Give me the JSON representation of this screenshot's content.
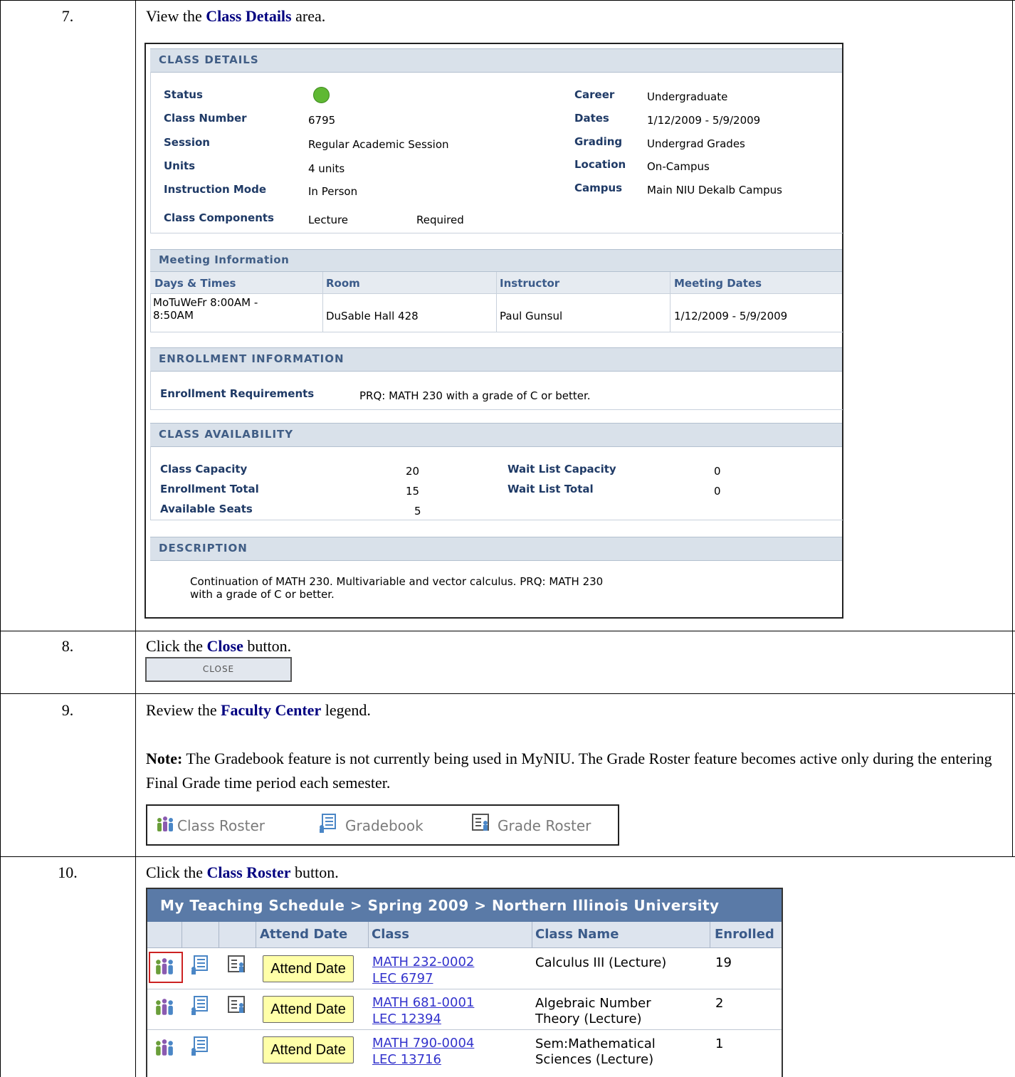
{
  "steps": [
    {
      "num": "7.",
      "pre": "View the ",
      "bold": "Class Details",
      "post": " area."
    },
    {
      "num": "8.",
      "pre": "Click the ",
      "bold": "Close",
      "post": " button."
    },
    {
      "num": "9.",
      "pre": "Review the ",
      "bold": "Faculty Center",
      "post": " legend."
    },
    {
      "num": "10.",
      "pre": "Click the ",
      "bold": "Class Roster",
      "post": " button."
    }
  ],
  "note": {
    "label": "Note:",
    "text": " The Gradebook feature is not currently being used in MyNIU. The Grade Roster feature becomes active only during the entering Final Grade time period each semester."
  },
  "class_details": {
    "header": "CLASS DETAILS",
    "left": [
      {
        "label": "Status",
        "value": ""
      },
      {
        "label": "Class Number",
        "value": "6795"
      },
      {
        "label": "Session",
        "value": "Regular Academic Session"
      },
      {
        "label": "Units",
        "value": "4 units"
      },
      {
        "label": "Instruction Mode",
        "value": "In Person"
      }
    ],
    "right": [
      {
        "label": "Career",
        "value": "Undergraduate"
      },
      {
        "label": "Dates",
        "value": "1/12/2009 - 5/9/2009"
      },
      {
        "label": "Grading",
        "value": "Undergrad Grades"
      },
      {
        "label": "Location",
        "value": "On-Campus"
      },
      {
        "label": "Campus",
        "value": "Main NIU Dekalb Campus"
      }
    ],
    "components": {
      "label": "Class Components",
      "type": "Lecture",
      "req": "Required"
    },
    "status_color": "#5fb833"
  },
  "meeting": {
    "header": "Meeting Information",
    "columns": [
      "Days & Times",
      "Room",
      "Instructor",
      "Meeting Dates"
    ],
    "row": {
      "days1": "MoTuWeFr 8:00AM -",
      "days2": "8:50AM",
      "room": "DuSable Hall 428",
      "instructor": "Paul Gunsul",
      "dates": "1/12/2009 - 5/9/2009"
    }
  },
  "enrollment": {
    "header": "ENROLLMENT INFORMATION",
    "label": "Enrollment Requirements",
    "value": "PRQ: MATH 230 with a grade of C or better."
  },
  "availability": {
    "header": "CLASS AVAILABILITY",
    "capacity_label": "Class Capacity",
    "capacity": "20",
    "total_label": "Enrollment Total",
    "total": "15",
    "seats_label": "Available Seats",
    "seats": "5",
    "wl_cap_label": "Wait List Capacity",
    "wl_cap": "0",
    "wl_total_label": "Wait List Total",
    "wl_total": "0"
  },
  "description": {
    "header": "DESCRIPTION",
    "line1": "Continuation of MATH 230. Multivariable and vector calculus. PRQ: MATH 230",
    "line2": "with a grade of C or better."
  },
  "close_button": "CLOSE",
  "legend": {
    "items": [
      "Class Roster",
      "Gradebook",
      "Grade Roster"
    ]
  },
  "schedule": {
    "title": "My Teaching Schedule > Spring 2009 > Northern Illinois University",
    "headers": [
      "Attend Date",
      "Class",
      "Class Name",
      "Enrolled"
    ],
    "attend_label": "Attend Date",
    "rows": [
      {
        "class1": "MATH 232-0002",
        "class2": "LEC 6797",
        "name1": "Calculus III (Lecture)",
        "name2": "",
        "enrolled": "19"
      },
      {
        "class1": "MATH 681-0001",
        "class2": "LEC 12394",
        "name1": "Algebraic Number",
        "name2": "Theory (Lecture)",
        "enrolled": "2"
      },
      {
        "class1": "MATH 790-0004",
        "class2": "LEC 13716",
        "name1": "Sem:Mathematical",
        "name2": "Sciences (Lecture)",
        "enrolled": "1"
      }
    ]
  }
}
